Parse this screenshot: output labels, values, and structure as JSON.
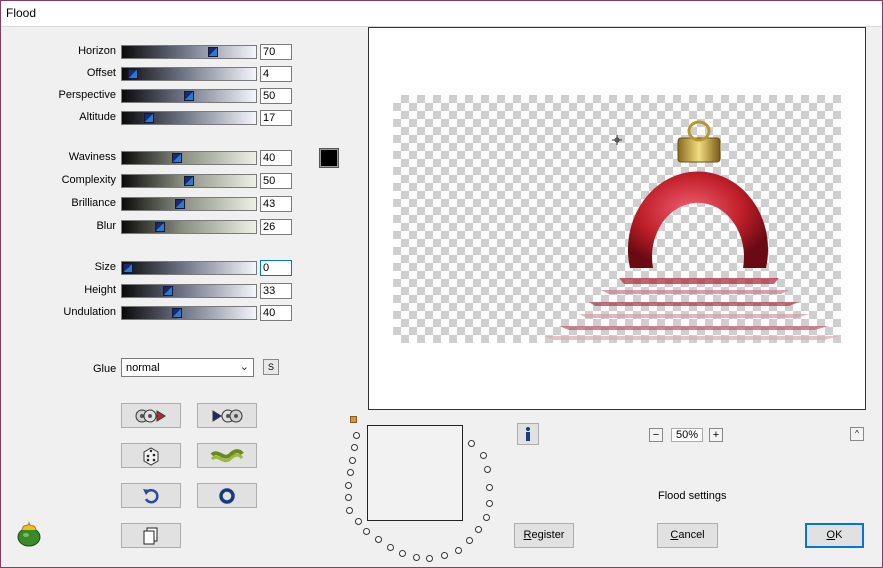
{
  "window": {
    "title": "Flood"
  },
  "sliders": [
    {
      "label": "Horizon",
      "value": "70",
      "level": 70
    },
    {
      "label": "Offset",
      "value": "4",
      "level": 4
    },
    {
      "label": "Perspective",
      "value": "50",
      "level": 50
    },
    {
      "label": "Altitude",
      "value": "17",
      "level": 17
    },
    {
      "label": "Waviness",
      "value": "40",
      "level": 40
    },
    {
      "label": "Complexity",
      "value": "50",
      "level": 50
    },
    {
      "label": "Brilliance",
      "value": "43",
      "level": 43
    },
    {
      "label": "Blur",
      "value": "26",
      "level": 26
    },
    {
      "label": "Size",
      "value": "0",
      "level": 0
    },
    {
      "label": "Height",
      "value": "33",
      "level": 33
    },
    {
      "label": "Undulation",
      "value": "40",
      "level": 40
    }
  ],
  "color_swatch": "#000000",
  "glue": {
    "label": "Glue",
    "value": "normal",
    "s_button": "S"
  },
  "tool_buttons": [
    "load-preset-icon",
    "save-preset-icon",
    "random-dice-icon",
    "wave-icon",
    "undo-icon",
    "reset-icon",
    "copy-icon"
  ],
  "zoom": {
    "value": "50%",
    "minus": "−",
    "plus": "+"
  },
  "info_button": "i",
  "collapse_button": "^",
  "settings_label": "Flood settings",
  "buttons": {
    "register": "Register",
    "cancel": "Cancel",
    "ok": "OK"
  },
  "colors": {
    "ornament": "#c0202a",
    "cap": "#c9a640",
    "accent": "#0078d7"
  }
}
